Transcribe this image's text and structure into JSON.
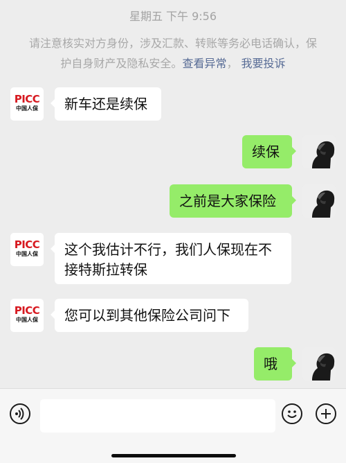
{
  "timestamp": "星期五 下午 9:56",
  "notice": {
    "text": "请注意核实对方身份，涉及汇款、转账等务必电话确认，保护自身财产及隐私安全。",
    "link_abnormal": "查看异常",
    "link_report": "我要投诉"
  },
  "contact_logo": {
    "brand": "PICC",
    "sub": "中国人保"
  },
  "messages": [
    {
      "from": "contact",
      "text": "新车还是续保"
    },
    {
      "from": "me",
      "text": "续保"
    },
    {
      "from": "me",
      "text": "之前是大家保险"
    },
    {
      "from": "contact",
      "text": "这个我估计不行，我们人保现在不接特斯拉转保"
    },
    {
      "from": "contact",
      "text": "您可以到其他保险公司问下"
    },
    {
      "from": "me",
      "text": "哦"
    }
  ],
  "bottombar": {
    "icons": [
      "voice-icon",
      "emoji-icon",
      "plus-icon"
    ],
    "input_value": ""
  },
  "colors": {
    "background": "#ededed",
    "incoming_bubble": "#ffffff",
    "outgoing_bubble": "#95ec69",
    "link": "#576b95",
    "brand_red": "#d71920"
  }
}
